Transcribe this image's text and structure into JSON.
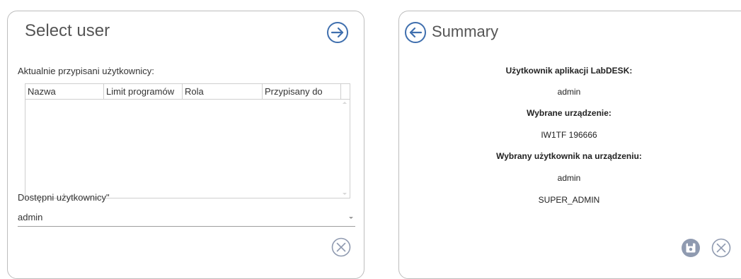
{
  "left_panel": {
    "title": "Select user",
    "assigned_label": "Aktualnie przypisani użytkownicy:",
    "table": {
      "columns": [
        "Nazwa",
        "Limit programów",
        "Rola",
        "Przypisany do"
      ],
      "rows": []
    },
    "available_label": "Dostępni użytkownicy\"",
    "select_value": "admin",
    "next_icon": "arrow-right-circle-icon",
    "close_icon": "close-circle-icon"
  },
  "right_panel": {
    "title": "Summary",
    "app_user_label": "Użytkownik aplikacji LabDESK:",
    "app_user_value": "admin",
    "device_label": "Wybrane urządzenie:",
    "device_value": "IW1TF 196666",
    "device_user_label": "Wybrany użytkownik na urządzeniu:",
    "device_user_value": "admin",
    "device_user_role": "SUPER_ADMIN",
    "back_icon": "arrow-left-circle-icon",
    "save_icon": "save-icon",
    "close_icon": "close-circle-icon"
  },
  "colors": {
    "accent": "#3f6fae",
    "icon_gray": "#8f9ab0",
    "border": "#bdbdbd"
  }
}
